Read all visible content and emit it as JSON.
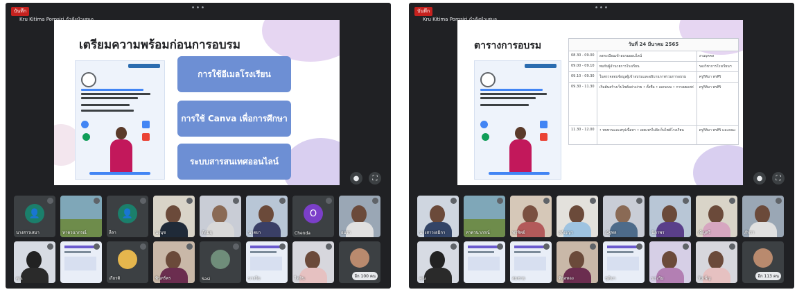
{
  "panels": [
    {
      "rec_badge": "บันทึก",
      "presenter_label": "Kru Kitima Pornsiri กำลังนำเสนอ",
      "slide": {
        "title": "เตรียมความพร้อมก่อนการอบรม",
        "menu": [
          "การใช้อีเมลโรงเรียน",
          "การใช้ Canva เพื่อการศึกษา",
          "ระบบสารสนเทศออนไลน์"
        ]
      },
      "tile_names": [
        "นางสาวเสมา",
        "หาดวนาภรณ์",
        "ลีลา",
        "นงนุช",
        "ต้อมยุ",
        "นาตยา",
        "Chenda",
        "อมรา",
        "คุณ",
        "",
        "เกียรติ",
        "พินทร์พร",
        "Sasi",
        "นางวิม",
        "ไพลิน",
        "ฯ"
      ],
      "avatar_letter": "O",
      "others_count": "อีก 100 คน"
    },
    {
      "rec_badge": "บันทึก",
      "presenter_label": "Kru Kitima Pornsiri กำลังนำเสนอ",
      "slide": {
        "title": "ตารางการอบรม",
        "table_header": "วันที่ 24 มีนาคม 2565",
        "rows": [
          {
            "time": "08.30 - 09.00",
            "activity": "ลงทะเบียนเข้าอบรมออนไลน์",
            "speaker": "งานบุคคล"
          },
          {
            "time": "09.00 - 09.10",
            "activity": "พบกับผู้อำนวยการโรงเรียน",
            "speaker": "รองวิชาการโรงเรียนฯ"
          },
          {
            "time": "09.10 - 09.30",
            "activity": "ในตรวจสอบข้อมูลผู้เข้าอบรมและอธิบายภาพรวมการอบรม",
            "speaker": "ครูกิติมา พรศิริ"
          },
          {
            "time": "09.30 - 11.30",
            "activity": "เริ่มต้นสร้างเว็บไซต์อย่างง่าย • ตั้งชื่อ • ออกแบบ • การเผยแพร่",
            "speaker": "ครูกิติมา พรศิริ"
          },
          {
            "time": "11.30 - 12.00",
            "activity": "• ทบทวนและสรุปเนื้อหา • เผยแพร่ไปยังเว็บไซต์โรงเรียน",
            "speaker": "ครูกิติมา พรศิริ และคณะ"
          }
        ]
      },
      "tile_names": [
        "นางสาวเอมิกา",
        "หาดวนาภรณ์",
        "พรทิพย์",
        "สุกัญญา",
        "ณัฐพล",
        "นิภาพร",
        "เพ็ญศรี",
        "ภัทรา",
        "คุณ",
        "",
        "สมชาย",
        "พิกุลทอง",
        "ชุติมา",
        "นางวิม",
        "วันเพ็ญ",
        ""
      ],
      "others_count": "อีก 113 คน"
    }
  ],
  "icons": {
    "mic": "microphone-icon",
    "fullscreen": "fullscreen-icon"
  },
  "colors": {
    "meet_bg": "#202124",
    "tile_bg": "#3c4043",
    "menu_box": "#6d8fd4",
    "record": "#c5221f"
  }
}
